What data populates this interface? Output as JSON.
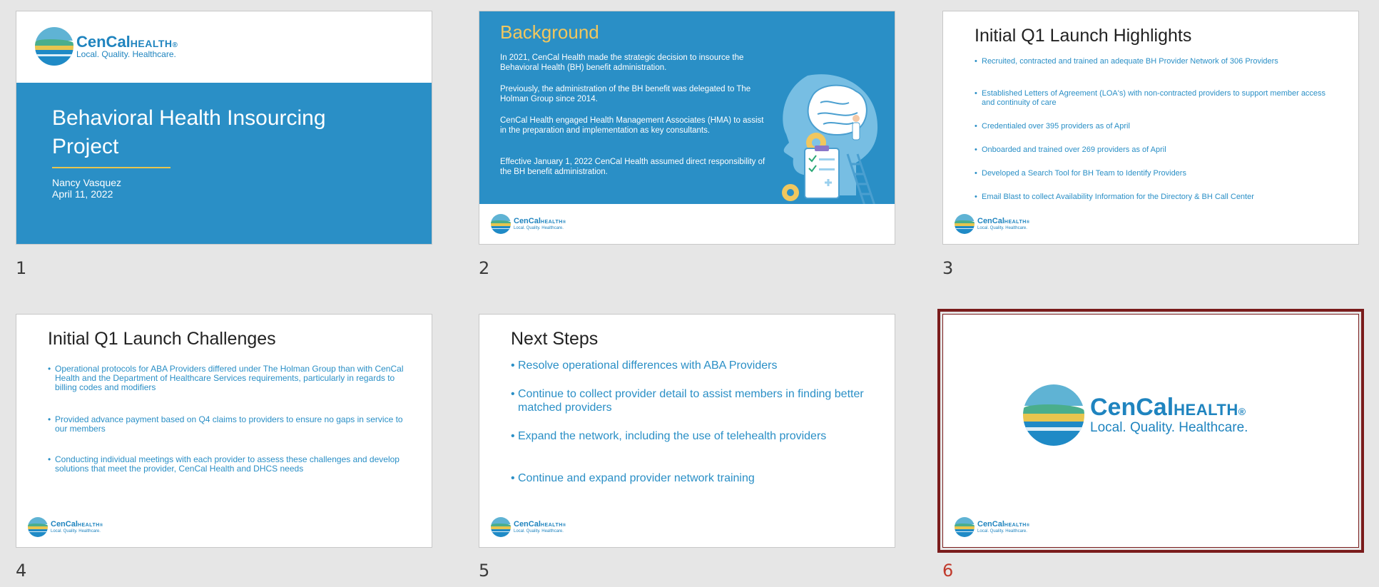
{
  "logo": {
    "brand_a": "CenCal",
    "brand_b": "HEALTH",
    "reg": "®",
    "tagline": "Local. Quality. Healthcare."
  },
  "slides": [
    {
      "number": "1",
      "title": "Behavioral Health Insourcing Project",
      "author": "Nancy Vasquez",
      "date": "April 11, 2022"
    },
    {
      "number": "2",
      "title": "Background",
      "paragraphs": [
        "In 2021, CenCal Health made the strategic decision to insource the Behavioral Health (BH) benefit administration.",
        "Previously, the administration of the BH benefit was delegated to The Holman Group since 2014.",
        "CenCal Health engaged Health Management Associates (HMA) to assist in the preparation and implementation as key consultants.",
        "Effective January 1, 2022 CenCal Health assumed direct responsibility of the BH benefit administration."
      ]
    },
    {
      "number": "3",
      "title": "Initial Q1 Launch Highlights",
      "bullets": [
        "Recruited, contracted and trained an adequate BH Provider Network of 306 Providers",
        "Established Letters of Agreement (LOA's) with non-contracted providers to support member access and continuity of care",
        "Credentialed over 395 providers as of April",
        "Onboarded and trained over 269 providers as of April",
        "Developed a Search Tool for BH Team to Identify Providers",
        "Email Blast to collect Availability Information for the Directory & BH Call Center"
      ]
    },
    {
      "number": "4",
      "title": "Initial Q1 Launch Challenges",
      "bullets": [
        "Operational protocols for ABA Providers differed under The Holman Group than with CenCal Health and the Department of Healthcare Services requirements, particularly in regards to billing codes and modifiers",
        "Provided advance payment based on Q4 claims to providers to ensure no gaps in service to our members",
        "Conducting individual meetings with each provider to assess these challenges and develop solutions that meet  the provider, CenCal Health and DHCS needs"
      ]
    },
    {
      "number": "5",
      "title": "Next Steps",
      "bullets": [
        "Resolve operational differences with ABA Providers",
        "Continue to collect provider detail to assist members in finding better matched providers",
        "Expand the network, including the use of telehealth providers",
        "Continue and expand provider network training"
      ]
    },
    {
      "number": "6"
    }
  ],
  "colors": {
    "accent_blue": "#2a8fc6",
    "gold": "#f1c75e",
    "selection": "#7a1c1c",
    "selected_number": "#c0392b"
  },
  "selected_slide": "6"
}
